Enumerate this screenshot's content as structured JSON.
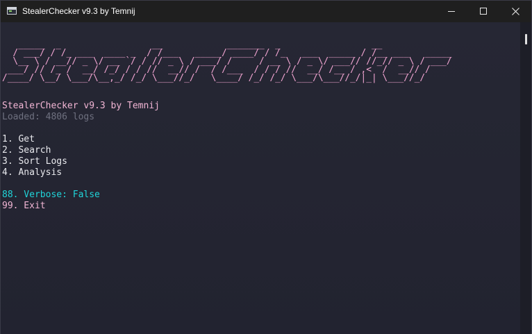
{
  "window": {
    "title": "StealerChecker v9.3 by Temnij",
    "icons": {
      "app": "terminal-icon",
      "minimize": "minimize-icon",
      "maximize": "maximize-icon",
      "close": "close-icon"
    }
  },
  "banner": {
    "ascii_lines": [
      "   _____  _                 __            _______  _                 __",
      "  / ___/ / /_ ___  ____ _  / /___   _____/ ____/ / /_   ___  _____ / /__ ___   _____",
      "  \\__ \\ / __// _ \\/ __ `/ / // _ \\ / ___/ /     / __ \\ / _ \\/ ___// //_// _ \\ / ___/",
      " ___/ // /_ /  __/ /_/ / / //  __// /  / /___  / / / //  __/ /__ / ,<  /  __// /",
      "/____/ \\__/ \\___/\\__,_/ /_/ \\___//_/   \\____/ /_/ /_/ \\___/\\___//_/|_| \\___//_/"
    ],
    "color": "#f2a5d2"
  },
  "console": {
    "header": "StealerChecker v9.3 by Temnij",
    "loaded": "Loaded: 4806 logs",
    "menu": [
      "1. Get",
      "2. Search",
      "3. Sort Logs",
      "4. Analysis"
    ],
    "verbose": "88. Verbose: False",
    "exit": "99. Exit"
  },
  "colors": {
    "background": "#252633",
    "titlebar": "#1f1f1f",
    "pink": "#f2b6d5",
    "gray": "#6f7180",
    "white": "#e9eaee",
    "cyan": "#20d4d9"
  }
}
